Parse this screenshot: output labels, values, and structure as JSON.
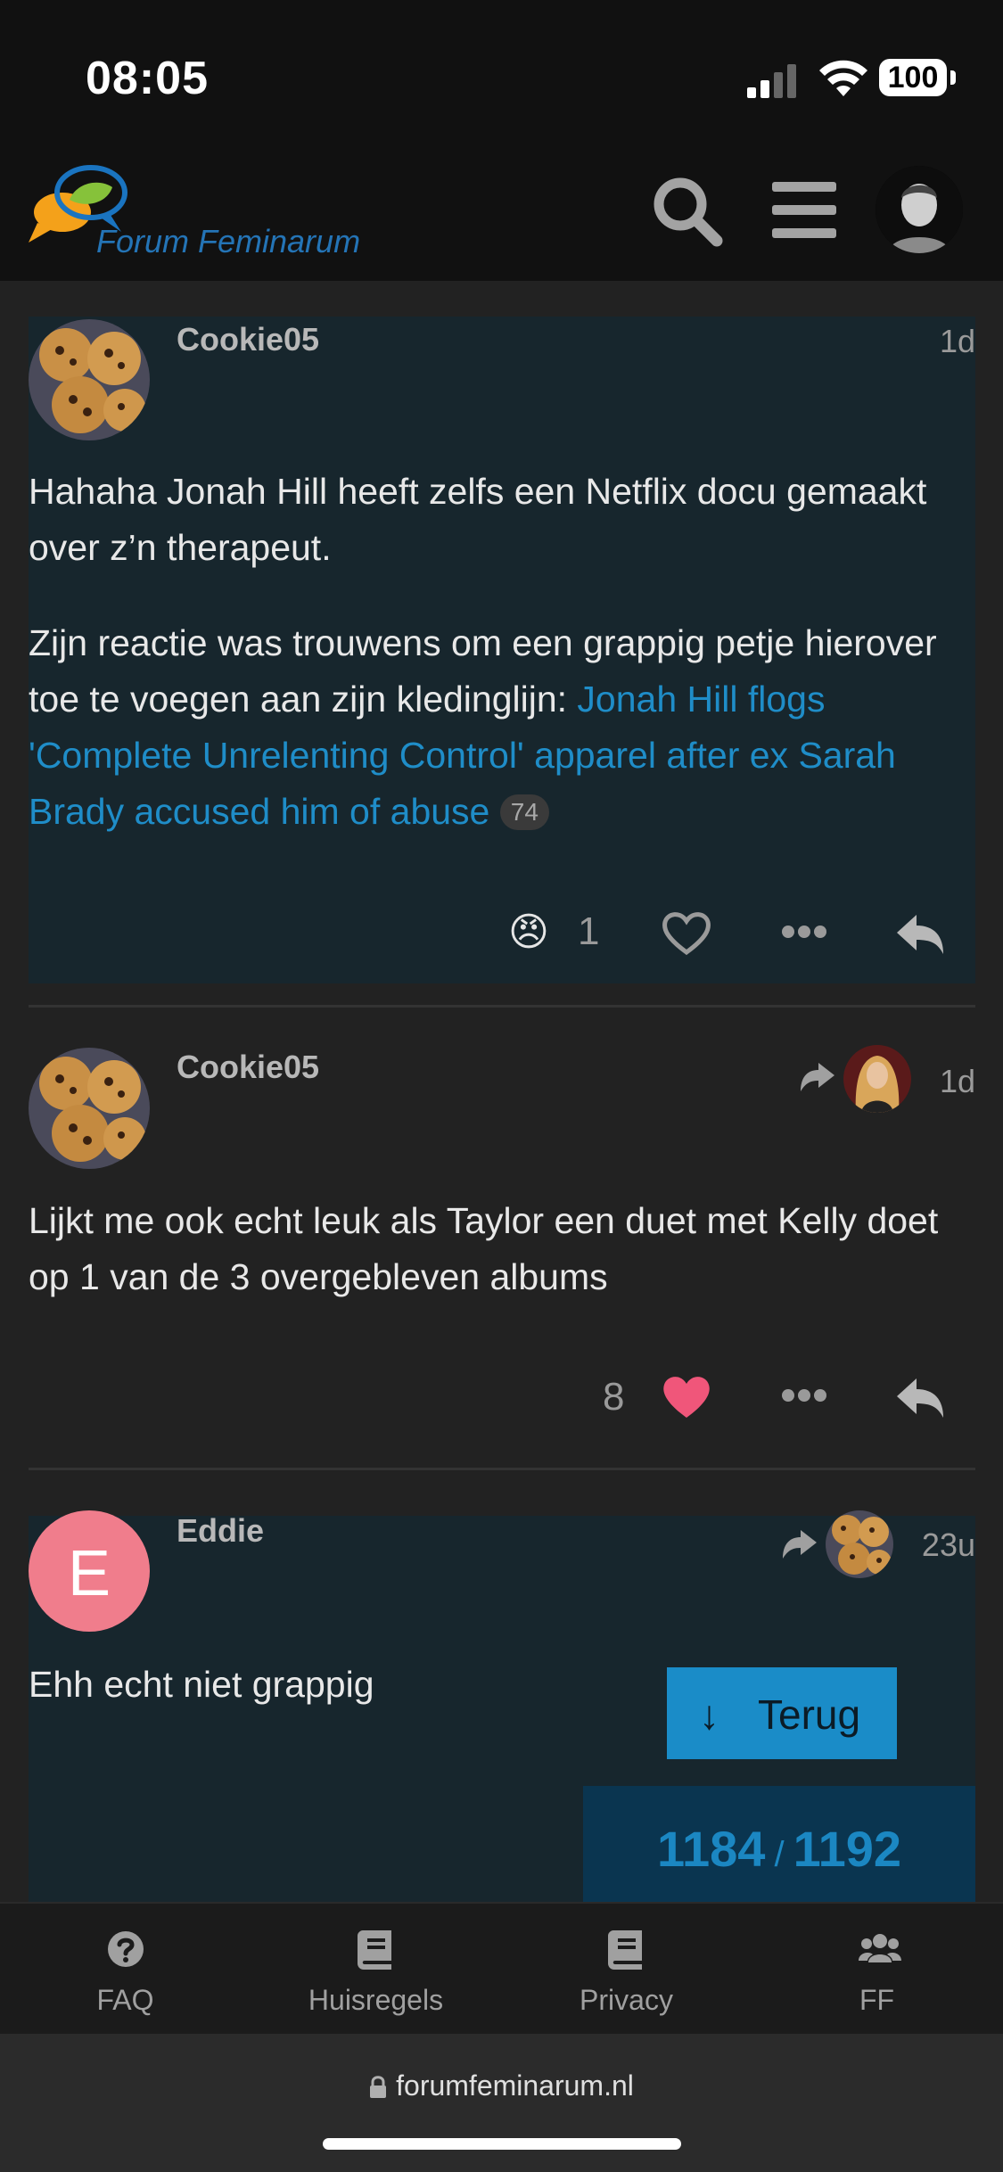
{
  "status_bar": {
    "time": "08:05",
    "battery": "100"
  },
  "header": {
    "logo_text": "Forum Feminarum"
  },
  "posts": [
    {
      "username": "Cookie05",
      "date": "1d",
      "paragraph1": "Hahaha Jonah Hill heeft zelfs een Netflix docu gemaakt over z’n therapeut.",
      "paragraph2": "Zijn reactie was trouwens om een grappig petje hierover toe te voegen aan zijn kledinglijn: ",
      "link_text": "Jonah Hill flogs 'Complete Unrelenting Control' apparel after ex Sarah Brady accused him of abuse",
      "link_count": "74",
      "reaction_emoji": "😠",
      "reaction_count": "1"
    },
    {
      "username": "Cookie05",
      "date": "1d",
      "text": "Lijkt me ook echt leuk als Taylor een duet met Kelly doet op 1 van de 3 overgebleven albums",
      "like_count": "8"
    },
    {
      "username": "Eddie",
      "avatar_letter": "E",
      "date": "23u",
      "text": "Ehh echt niet grappig"
    }
  ],
  "back_button": {
    "arrow": "↓",
    "label": "Terug"
  },
  "progress": {
    "current": "1184",
    "separator": "/",
    "total": "1192"
  },
  "tabs": [
    {
      "label": "FAQ",
      "icon": "question-circle-icon"
    },
    {
      "label": "Huisregels",
      "icon": "book-icon"
    },
    {
      "label": "Privacy",
      "icon": "book-icon"
    },
    {
      "label": "FF",
      "icon": "users-icon"
    }
  ],
  "url_bar": {
    "url": "forumfeminarum.nl"
  },
  "colors": {
    "accent": "#1a8cc8",
    "like": "#f0567a",
    "highlight_bg": "#17262d",
    "progress_bg": "#0a3550"
  }
}
